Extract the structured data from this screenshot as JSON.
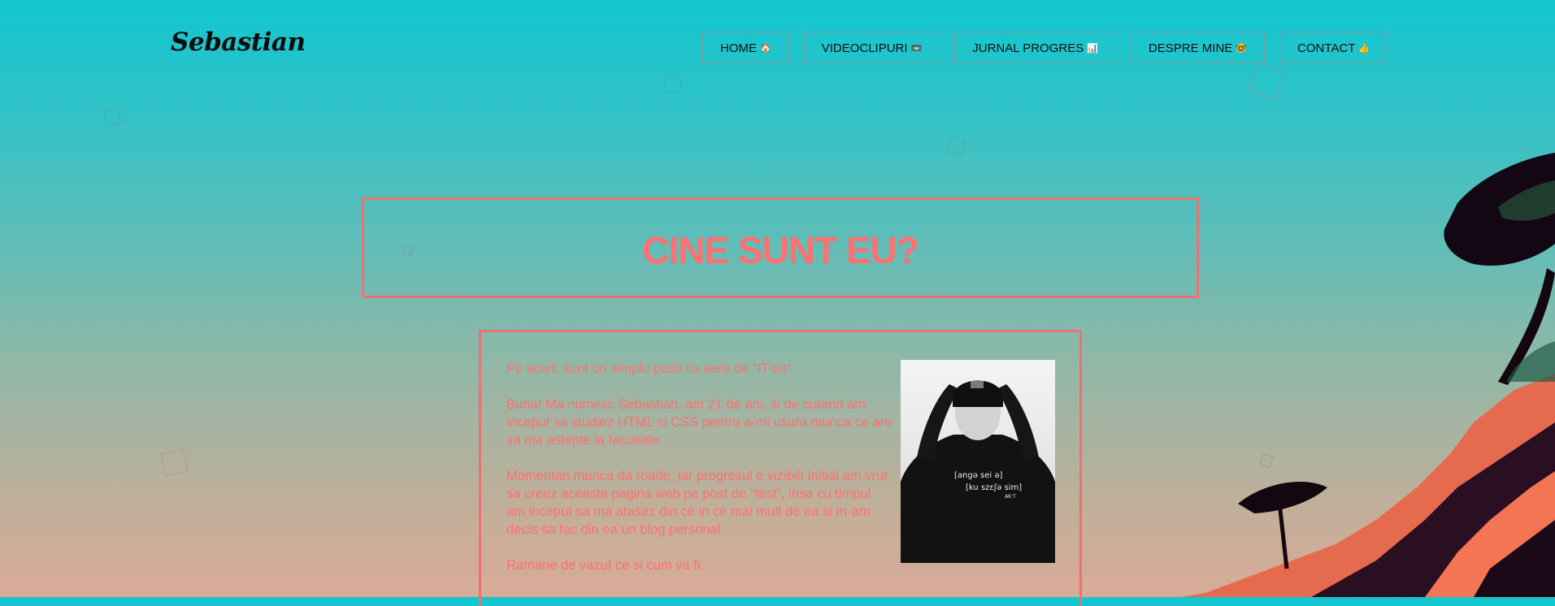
{
  "logo": "Sebastian",
  "nav": [
    {
      "label": "HOME",
      "emoji": "🏠"
    },
    {
      "label": "VIDEOCLIPURI",
      "emoji": "📼"
    },
    {
      "label": "JURNAL PROGRES",
      "emoji": "📊"
    },
    {
      "label": "DESPRE MINE",
      "emoji": "🤓"
    },
    {
      "label": "CONTACT",
      "emoji": "👍"
    }
  ],
  "hero": {
    "title": "CINE SUNT EU?"
  },
  "about": {
    "paragraphs": [
      "Pe scurt, sunt un simplu pusti cu aere de \"IT-ist\".",
      "Buna! Ma numesc Sebastian, am 21 de ani, si de curand am inceput sa studiez HTML si CSS pentru a-mi usura munca ce are sa ma astepte la facultate.",
      "Momentan munca da roade, iar progresul e vizibil! Initial am vrut sa creez aceasta pagina web pe post de \"test\", insa cu timpul am inceput sa ma atasez din ce in ce mai mult de ea si m-am decis sa fac din ea un blog personal.",
      "Ramane de vazut ce si cum va fi."
    ],
    "photo_hoodie_text": [
      "[angə sei ə]",
      "[ku szɛʃə sim]",
      "AK·T"
    ]
  },
  "colors": {
    "accent": "#ff6f6f",
    "sky_top": "#12c6cf",
    "sky_bottom": "#d9ab97"
  }
}
